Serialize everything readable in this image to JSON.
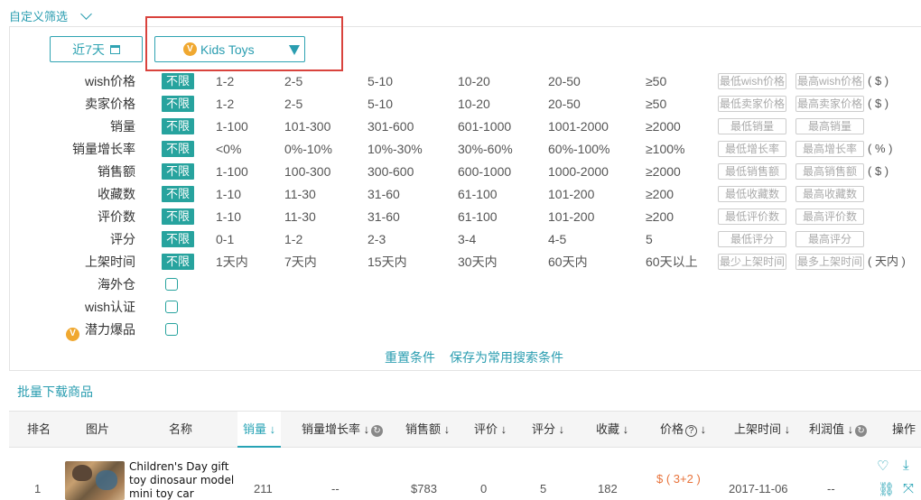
{
  "header": {
    "title": "自定义筛选"
  },
  "controls": {
    "date_range": "近7天",
    "category": "Kids Toys",
    "vip_mark": "V"
  },
  "filters": [
    {
      "label": "wish价格",
      "all": "不限",
      "options": [
        "1-2",
        "2-5",
        "5-10",
        "10-20",
        "20-50",
        "≥50"
      ],
      "min_placeholder": "最低wish价格",
      "max_placeholder": "最高wish价格",
      "unit": "( $ )"
    },
    {
      "label": "卖家价格",
      "all": "不限",
      "options": [
        "1-2",
        "2-5",
        "5-10",
        "10-20",
        "20-50",
        "≥50"
      ],
      "min_placeholder": "最低卖家价格",
      "max_placeholder": "最高卖家价格",
      "unit": "( $ )"
    },
    {
      "label": "销量",
      "all": "不限",
      "options": [
        "1-100",
        "101-300",
        "301-600",
        "601-1000",
        "1001-2000",
        "≥2000"
      ],
      "min_placeholder": "最低销量",
      "max_placeholder": "最高销量",
      "unit": ""
    },
    {
      "label": "销量增长率",
      "all": "不限",
      "options": [
        "<0%",
        "0%-10%",
        "10%-30%",
        "30%-60%",
        "60%-100%",
        "≥100%"
      ],
      "min_placeholder": "最低增长率",
      "max_placeholder": "最高增长率",
      "unit": "( % )"
    },
    {
      "label": "销售额",
      "all": "不限",
      "options": [
        "1-100",
        "100-300",
        "300-600",
        "600-1000",
        "1000-2000",
        "≥2000"
      ],
      "min_placeholder": "最低销售额",
      "max_placeholder": "最高销售额",
      "unit": "( $ )"
    },
    {
      "label": "收藏数",
      "all": "不限",
      "options": [
        "1-10",
        "11-30",
        "31-60",
        "61-100",
        "101-200",
        "≥200"
      ],
      "min_placeholder": "最低收藏数",
      "max_placeholder": "最高收藏数",
      "unit": ""
    },
    {
      "label": "评价数",
      "all": "不限",
      "options": [
        "1-10",
        "11-30",
        "31-60",
        "61-100",
        "101-200",
        "≥200"
      ],
      "min_placeholder": "最低评价数",
      "max_placeholder": "最高评价数",
      "unit": ""
    },
    {
      "label": "评分",
      "all": "不限",
      "options": [
        "0-1",
        "1-2",
        "2-3",
        "3-4",
        "4-5",
        "5"
      ],
      "min_placeholder": "最低评分",
      "max_placeholder": "最高评分",
      "unit": ""
    },
    {
      "label": "上架时间",
      "all": "不限",
      "options": [
        "1天内",
        "7天内",
        "15天内",
        "30天内",
        "60天内",
        "60天以上"
      ],
      "min_placeholder": "最少上架时间",
      "max_placeholder": "最多上架时间",
      "unit": "( 天内 )"
    }
  ],
  "checkbox_filters": [
    {
      "label": "海外仓",
      "vip": false
    },
    {
      "label": "wish认证",
      "vip": false
    },
    {
      "label": "潜力爆品",
      "vip": true
    }
  ],
  "actions": {
    "reset": "重置条件",
    "save": "保存为常用搜索条件",
    "batch_download": "批量下载商品"
  },
  "table": {
    "headers": {
      "rank": "排名",
      "image": "图片",
      "name": "名称",
      "sales": "销量 ↓",
      "growth": "销量增长率 ↓",
      "revenue": "销售额 ↓",
      "reviews": "评价 ↓",
      "rating": "评分 ↓",
      "favorites": "收藏 ↓",
      "price": "价格",
      "price_arrow": "↓",
      "listed": "上架时间 ↓",
      "profit": "利润值 ↓",
      "ops": "操作"
    },
    "rows": [
      {
        "rank": "1",
        "name": "Children's Day gift toy dinosaur model mini toy car",
        "sales": "211",
        "growth": "--",
        "revenue": "$783",
        "reviews": "0",
        "rating": "5",
        "favorites": "182",
        "price": "$ ( 3+2 )",
        "listed": "2017-11-06",
        "profit": "--"
      }
    ]
  }
}
